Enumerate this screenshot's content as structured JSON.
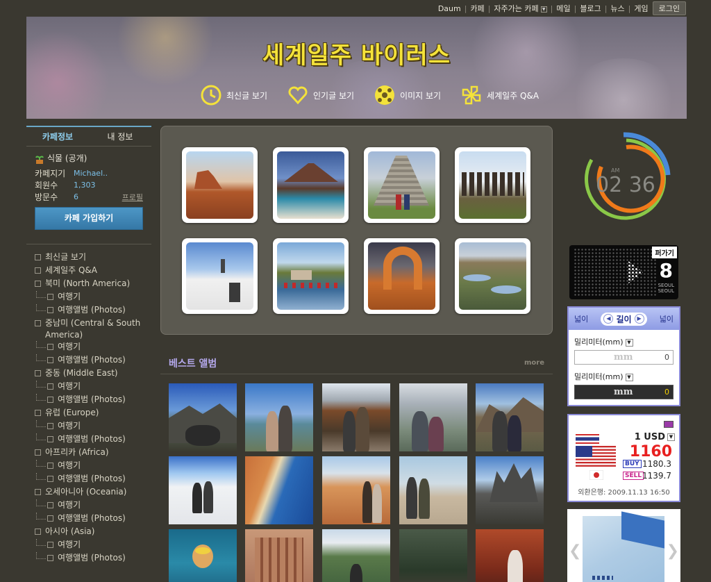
{
  "topnav": {
    "items": [
      "Daum",
      "카페",
      "자주가는 카페",
      "메일",
      "블로그",
      "뉴스",
      "게임"
    ],
    "login": "로그인"
  },
  "banner": {
    "title": "세계일주 바이러스",
    "menu": [
      "최신글 보기",
      "인기글 보기",
      "이미지 보기",
      "세계일주 Q&A"
    ]
  },
  "sidebar": {
    "tabs": [
      "카페정보",
      "내 정보"
    ],
    "level": "식물 (공개)",
    "rows": [
      {
        "k": "카페지기",
        "v": "Michael.."
      },
      {
        "k": "회원수",
        "v": "1,303"
      },
      {
        "k": "방문수",
        "v": "6",
        "link": "프로필"
      }
    ],
    "join": "카페 가입하기",
    "menu": [
      {
        "label": "최신글 보기",
        "sub": false
      },
      {
        "label": "세계일주 Q&A",
        "sub": false
      },
      {
        "label": "북미 (North America)",
        "sub": false
      },
      {
        "label": "여행기",
        "sub": true
      },
      {
        "label": "여행앨범 (Photos)",
        "sub": true
      },
      {
        "label": "중남미 (Central & South America)",
        "sub": false
      },
      {
        "label": "여행기",
        "sub": true
      },
      {
        "label": "여행앨범 (Photos)",
        "sub": true
      },
      {
        "label": "중동 (Middle East)",
        "sub": false
      },
      {
        "label": "여행기",
        "sub": true
      },
      {
        "label": "여행앨범 (Photos)",
        "sub": true
      },
      {
        "label": "유럽 (Europe)",
        "sub": false
      },
      {
        "label": "여행기",
        "sub": true
      },
      {
        "label": "여행앨범 (Photos)",
        "sub": true
      },
      {
        "label": "아프리카 (Africa)",
        "sub": false
      },
      {
        "label": "여행기",
        "sub": true
      },
      {
        "label": "여행앨범 (Photos)",
        "sub": true
      },
      {
        "label": "오세아니아 (Oceania)",
        "sub": false
      },
      {
        "label": "여행기",
        "sub": true
      },
      {
        "label": "여행앨범 (Photos)",
        "sub": true
      },
      {
        "label": "아시아 (Asia)",
        "sub": false
      },
      {
        "label": "여행기",
        "sub": true
      },
      {
        "label": "여행앨범 (Photos)",
        "sub": true
      }
    ]
  },
  "best": {
    "title": "베스트 앨범",
    "more": "more"
  },
  "clock": {
    "ampm": "AM",
    "time": "02 36"
  },
  "led": {
    "tag": "퍼가기",
    "num": "8",
    "city1": "SEOUL",
    "city2": "SEOUL"
  },
  "unit": {
    "left": "넓이",
    "mid": "길이",
    "right": "넓이",
    "from_label": "밀리미터(mm)",
    "to_label": "밀리미터(mm)",
    "unit_ph": "mm",
    "from_val": "0",
    "to_val": "0"
  },
  "fx": {
    "currency": "1 USD",
    "rate": "1160",
    "buy_label": "BUY",
    "buy": "1180.3",
    "sell_label": "SELL",
    "sell": "1139.7",
    "bank": "외환은행: 2009.11.13 16:50"
  }
}
